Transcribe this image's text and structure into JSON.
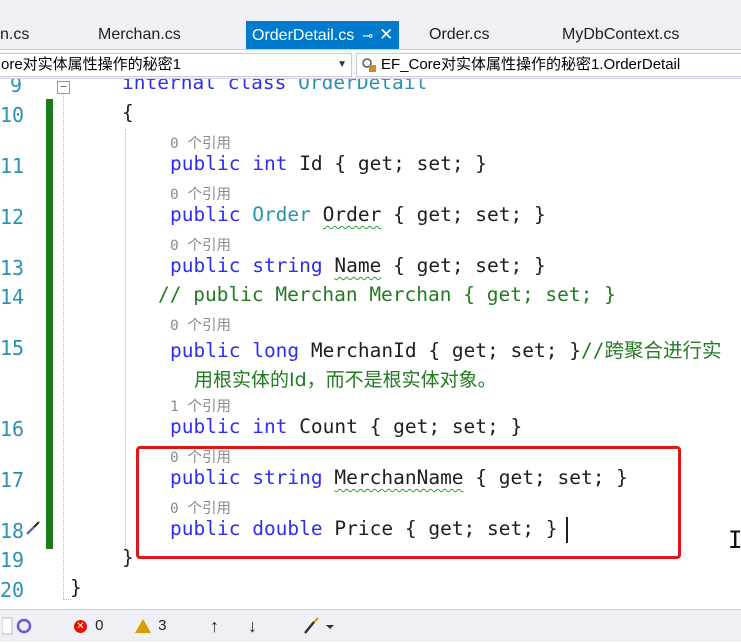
{
  "tabs": [
    {
      "label": "n.cs"
    },
    {
      "label": "Merchan.cs"
    },
    {
      "label": "OrderDetail.cs",
      "active": true
    },
    {
      "label": "Order.cs"
    },
    {
      "label": "MyDbContext.cs"
    }
  ],
  "tab_icons": {
    "pin": "⊸",
    "close": "✕"
  },
  "nav": {
    "project": "ore对实体属性操作的秘密1",
    "member": "EF_Core对实体属性操作的秘密1.OrderDetail"
  },
  "line_numbers": [
    "9",
    "10",
    "11",
    "12",
    "13",
    "14",
    "15",
    "",
    "16",
    "17",
    "18",
    "19",
    "20"
  ],
  "code": {
    "l9_kw": "internal class",
    "l9_name": "OrderDetail",
    "l10": "{",
    "ref0": "0 个引用",
    "ref1": "1 个引用",
    "public": "public",
    "get_set": "{ get; set; }",
    "l11_type": "int",
    "l11_name": "Id",
    "l12_type": "Order",
    "l12_name": "Order",
    "l13_type": "string",
    "l13_name": "Name",
    "l14_comment": "// public Merchan Merchan { get; set; }",
    "l15_type": "long",
    "l15_name": "MerchanId",
    "l15_comment": "//跨聚合进行实",
    "l15_comment_wrap": "用根实体的Id，而不是根实体对象。",
    "l16_type": "int",
    "l16_name": "Count",
    "l17_type": "string",
    "l17_name": "MerchanName",
    "l18_type": "double",
    "l18_name": "Price",
    "l19": "}",
    "l20": "}"
  },
  "status": {
    "errors": "0",
    "warnings": "3",
    "up_arrow": "↑",
    "down_arrow": "↓"
  },
  "colors": {
    "highlight_box": "#e0141b",
    "keyword": "#2e2ef0",
    "type": "#2b91af",
    "comment": "#237a23"
  }
}
